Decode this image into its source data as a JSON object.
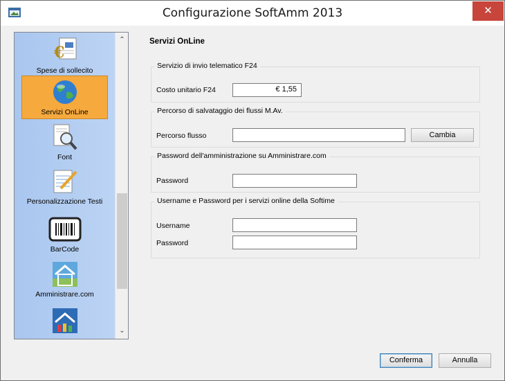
{
  "window": {
    "title": "Configurazione SoftAmm 2013",
    "close_symbol": "✕",
    "icon": "app-window-icon"
  },
  "sidebar": {
    "items": [
      {
        "label": "Spese di sollecito",
        "icon": "euro-document-icon",
        "selected": false
      },
      {
        "label": "Servizi OnLine",
        "icon": "globe-icon",
        "selected": true
      },
      {
        "label": "Font",
        "icon": "magnifier-document-icon",
        "selected": false
      },
      {
        "label": "Personalizzazione Testi",
        "icon": "notepad-pencil-icon",
        "selected": false
      },
      {
        "label": "BarCode",
        "icon": "barcode-icon",
        "selected": false
      },
      {
        "label": "Amministrare.com",
        "icon": "house-icon",
        "selected": false
      },
      {
        "label": "",
        "icon": "house-chart-icon",
        "selected": false
      }
    ],
    "scroll_up": "⌃",
    "scroll_down": "⌄"
  },
  "main": {
    "title": "Servizi OnLine",
    "groups": [
      {
        "title": "Servizio di invio telematico F24",
        "fields": [
          {
            "label": "Costo unitario F24",
            "value": "€ 1,55"
          }
        ]
      },
      {
        "title": "Percorso di salvataggio dei flussi M.Av.",
        "fields": [
          {
            "label": "Percorso flusso",
            "value": ""
          }
        ],
        "button": "Cambia"
      },
      {
        "title": "Password dell'amministrazione su Amministrare.com",
        "fields": [
          {
            "label": "Password",
            "value": ""
          }
        ]
      },
      {
        "title": "Username e Password per i servizi online della Softime",
        "fields": [
          {
            "label": "Username",
            "value": ""
          },
          {
            "label": "Password",
            "value": ""
          }
        ]
      }
    ]
  },
  "footer": {
    "confirm": "Conferma",
    "cancel": "Annulla"
  },
  "colors": {
    "selected_item": "#f6a93d",
    "sidebar_bg": "#b3cdf1",
    "close_button": "#c7453a"
  }
}
